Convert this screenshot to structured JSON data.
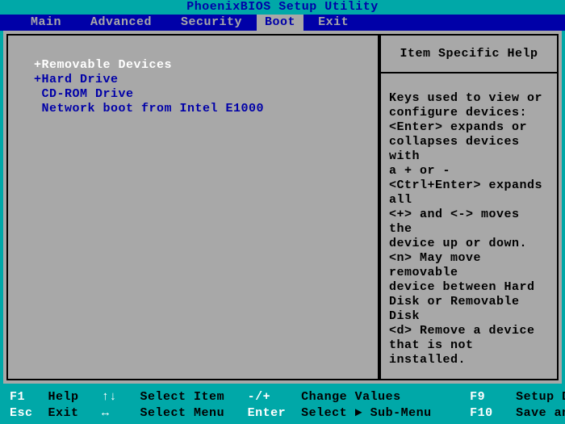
{
  "title": "PhoenixBIOS Setup Utility",
  "menu": {
    "items": [
      "Main",
      "Advanced",
      "Security",
      "Boot",
      "Exit"
    ],
    "active_index": 3
  },
  "boot": {
    "items": [
      {
        "prefix": "+",
        "label": "Removable Devices",
        "selected": true
      },
      {
        "prefix": "+",
        "label": "Hard Drive",
        "selected": false
      },
      {
        "prefix": " ",
        "label": "CD-ROM Drive",
        "selected": false
      },
      {
        "prefix": " ",
        "label": "Network boot from Intel E1000",
        "selected": false
      }
    ]
  },
  "help": {
    "title": "Item Specific Help",
    "body": "Keys used to view or\nconfigure devices:\n<Enter> expands or\ncollapses devices with\na + or -\n<Ctrl+Enter> expands\nall\n<+> and <-> moves the\ndevice up or down.\n<n> May move removable\ndevice between Hard\nDisk or Removable Disk\n<d> Remove a device\nthat is not installed."
  },
  "footer": {
    "row1": [
      {
        "key": "F1",
        "label": "Help"
      },
      {
        "key": "↑↓",
        "label": "Select Item"
      },
      {
        "key": "-/+",
        "label": "Change Values"
      },
      {
        "key": "F9",
        "label": "Setup Defaults"
      }
    ],
    "row2": [
      {
        "key": "Esc",
        "label": "Exit"
      },
      {
        "key": "↔",
        "label": "Select Menu"
      },
      {
        "key": "Enter",
        "label": "Select ► Sub-Menu"
      },
      {
        "key": "F10",
        "label": "Save and Exit"
      }
    ]
  }
}
